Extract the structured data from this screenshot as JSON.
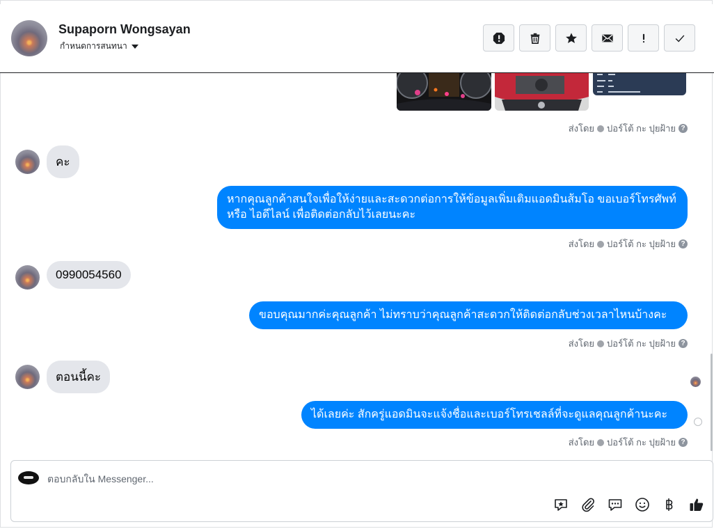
{
  "header": {
    "contact_name": "Supaporn Wongsayan",
    "assign_label": "กำหนดการสนทนา",
    "actions": [
      "spam-icon",
      "trash-icon",
      "star-icon",
      "envelope-icon",
      "exclamation-icon",
      "check-icon"
    ]
  },
  "messages": {
    "sent_by_text": "ส่งโดย",
    "sender_name": "ปอร์โต้ กะ ปุยฝ้าย",
    "in1": "คะ",
    "out1": "หากคุณลูกค้าสนใจเพื่อให้ง่ายและสะดวกต่อการให้ข้อมูลเพิ่มเติมแอดมินส้มโอ ขอเบอร์โทรศัพท์ หรือ ไอดีไลน์ เพื่อติดต่อกลับไว้เลยนะคะ",
    "in2": "0990054560",
    "out2": "ขอบคุณมากค่ะคุณลูกค้า ไม่ทราบว่าคุณลูกค้าสะดวกให้ติดต่อกลับช่วงเวลาไหนบ้างคะ",
    "in3": "ตอนนี้คะ",
    "out3": "ได้เลยค่ะ สักครู่แอดมินจะแจ้งชื่อและเบอร์โทรเชลล์ที่จะดูแลคุณลูกค้านะคะ"
  },
  "composer": {
    "placeholder": "ตอบกลับใน Messenger...",
    "tools": [
      "sticker-icon",
      "attachment-icon",
      "saved-reply-icon",
      "emoji-icon",
      "baht-icon",
      "like-icon"
    ]
  },
  "colors": {
    "outgoing_bubble": "#0084ff",
    "incoming_bubble": "#e4e6eb"
  }
}
